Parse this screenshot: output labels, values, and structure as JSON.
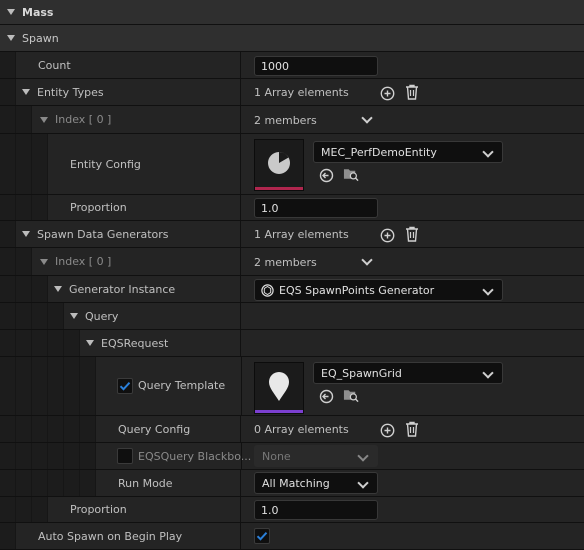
{
  "sections": {
    "mass": "Mass",
    "spawn": "Spawn"
  },
  "count": {
    "label": "Count",
    "value": "1000"
  },
  "entity_types": {
    "label": "Entity Types",
    "summary": "1 Array elements",
    "index_label": "Index [ 0 ]",
    "members": "2 members",
    "entity_config": {
      "label": "Entity Config",
      "asset": "MEC_PerfDemoEntity"
    },
    "proportion": {
      "label": "Proportion",
      "value": "1.0"
    }
  },
  "spawn_data_generators": {
    "label": "Spawn Data Generators",
    "summary": "1 Array elements",
    "index_label": "Index [ 0 ]",
    "members": "2 members",
    "generator_instance": {
      "label": "Generator Instance",
      "value": "EQS SpawnPoints Generator"
    },
    "query": "Query",
    "eqs_request": "EQSRequest",
    "query_template": {
      "label": "Query Template",
      "asset": "EQ_SpawnGrid",
      "checked": true
    },
    "query_config": {
      "label": "Query Config",
      "summary": "0 Array elements"
    },
    "eqs_blackboard": {
      "label": "EQSQuery Blackbo...",
      "value": "None",
      "checked": false
    },
    "run_mode": {
      "label": "Run Mode",
      "value": "All Matching"
    },
    "proportion": {
      "label": "Proportion",
      "value": "1.0"
    }
  },
  "auto_spawn": {
    "label": "Auto Spawn on Begin Play",
    "checked": true
  },
  "colors": {
    "entity_thumb_bar": "#b0264e",
    "query_thumb_bar": "#7b3fd0",
    "checkbox_accent": "#2a7fd9"
  }
}
